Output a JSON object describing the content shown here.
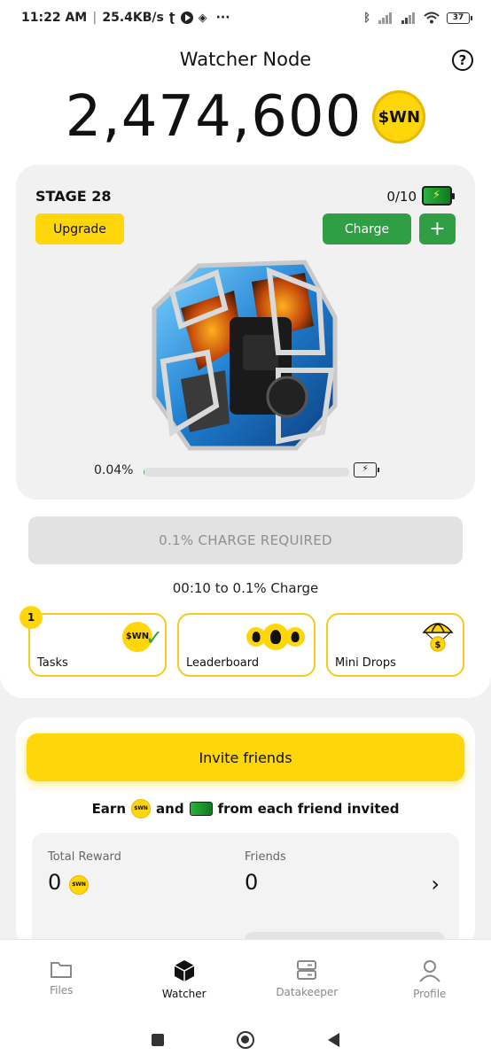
{
  "status_bar": {
    "time": "11:22 AM",
    "speed": "25.4KB/s",
    "dots": "···",
    "battery": "37"
  },
  "header": {
    "title": "Watcher Node",
    "help": "?"
  },
  "balance": {
    "value": "2,474,600",
    "coin_label": "$WN"
  },
  "node": {
    "stage": "STAGE 28",
    "charges": "0/10",
    "upgrade_label": "Upgrade",
    "charge_label": "Charge",
    "plus_label": "+",
    "progress_text": "0.04%",
    "progress_fraction": 0.0004
  },
  "charge_required": "0.1% CHARGE REQUIRED",
  "timer": "00:10 to 0.1% Charge",
  "quick": {
    "tasks_label": "Tasks",
    "tasks_badge": "1",
    "leaderboard_label": "Leaderboard",
    "minidrops_label": "Mini Drops"
  },
  "invite": {
    "button_label": "Invite friends",
    "earn": "Earn",
    "and": "and",
    "from_each": "from each friend invited"
  },
  "rewards": {
    "total_label": "Total Reward",
    "total_value": "0",
    "friends_label": "Friends",
    "friends_value": "0"
  },
  "nav": {
    "files": "Files",
    "watcher": "Watcher",
    "datakeeper": "Datakeeper",
    "profile": "Profile"
  },
  "colors": {
    "accent_yellow": "#ffd60a",
    "accent_green": "#2f9e44",
    "card_gray": "#f1f1f1"
  }
}
